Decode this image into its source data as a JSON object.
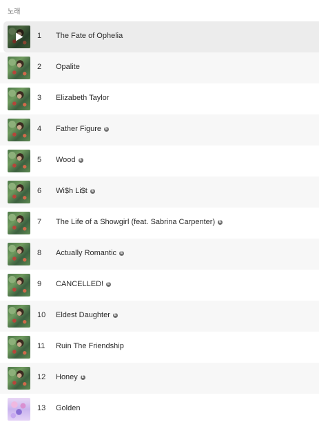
{
  "section": {
    "header": "노래"
  },
  "tracks": [
    {
      "number": "1",
      "title": "The Fate of Ophelia",
      "explicit": false,
      "artwork": "showgirl",
      "state": "hover-play"
    },
    {
      "number": "2",
      "title": "Opalite",
      "explicit": false,
      "artwork": "showgirl"
    },
    {
      "number": "3",
      "title": "Elizabeth Taylor",
      "explicit": false,
      "artwork": "showgirl"
    },
    {
      "number": "4",
      "title": "Father Figure",
      "explicit": true,
      "artwork": "showgirl"
    },
    {
      "number": "5",
      "title": "Wood",
      "explicit": true,
      "artwork": "showgirl"
    },
    {
      "number": "6",
      "title": "Wi$h Li$t",
      "explicit": true,
      "artwork": "showgirl"
    },
    {
      "number": "7",
      "title": "The Life of a Showgirl (feat. Sabrina Carpenter)",
      "explicit": true,
      "artwork": "showgirl"
    },
    {
      "number": "8",
      "title": "Actually Romantic",
      "explicit": true,
      "artwork": "showgirl"
    },
    {
      "number": "9",
      "title": "CANCELLED!",
      "explicit": true,
      "artwork": "showgirl"
    },
    {
      "number": "10",
      "title": "Eldest Daughter",
      "explicit": true,
      "artwork": "showgirl"
    },
    {
      "number": "11",
      "title": "Ruin The Friendship",
      "explicit": false,
      "artwork": "showgirl"
    },
    {
      "number": "12",
      "title": "Honey",
      "explicit": true,
      "artwork": "showgirl"
    },
    {
      "number": "13",
      "title": "Golden",
      "explicit": false,
      "artwork": "golden"
    }
  ],
  "icons": {
    "play": "play-icon",
    "explicit": "explicit-icon"
  },
  "colors": {
    "selected_row": "#ececec",
    "alt_row": "#f7f7f7",
    "explicit_badge": "#6f6f6f"
  }
}
